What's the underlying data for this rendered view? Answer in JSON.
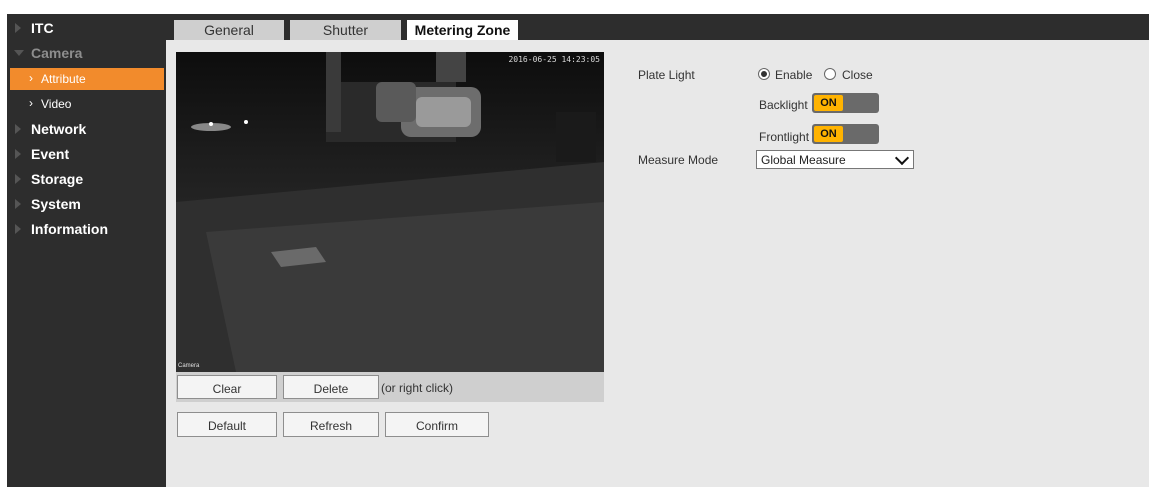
{
  "sidebar": {
    "items": [
      {
        "label": "ITC"
      },
      {
        "label": "Camera"
      },
      {
        "label": "Attribute"
      },
      {
        "label": "Video"
      },
      {
        "label": "Network"
      },
      {
        "label": "Event"
      },
      {
        "label": "Storage"
      },
      {
        "label": "System"
      },
      {
        "label": "Information"
      }
    ],
    "active_color": "#f28b2c",
    "background": "#2d2d2d"
  },
  "tabs": [
    {
      "label": "General"
    },
    {
      "label": "Shutter"
    },
    {
      "label": "Metering Zone"
    }
  ],
  "video": {
    "timestamp": "2016-06-25 14:23:05",
    "osd": "Camera"
  },
  "video_toolbar": {
    "clear_label": "Clear",
    "delete_label": "Delete",
    "hint": "(or right click)"
  },
  "footer": {
    "default_label": "Default",
    "refresh_label": "Refresh",
    "confirm_label": "Confirm"
  },
  "form": {
    "plate_light_label": "Plate Light",
    "enable_label": "Enable",
    "close_label": "Close",
    "backlight_label": "Backlight",
    "backlight_state": "ON",
    "frontlight_label": "Frontlight",
    "frontlight_state": "ON",
    "measure_mode_label": "Measure Mode",
    "measure_mode_value": "Global Measure"
  },
  "colors": {
    "toggle_on": "#ffb300",
    "toggle_track": "#6a6a6a"
  }
}
